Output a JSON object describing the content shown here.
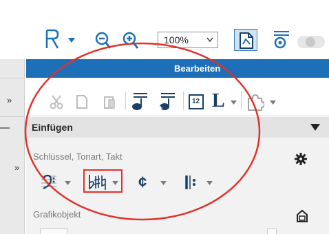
{
  "top_toolbar": {
    "zoom_level": "100%",
    "toggle_state": "off"
  },
  "ribbon": {
    "bearbeiten_title": "Bearbeiten",
    "edit_tools": [
      "cut-icon",
      "copy-icon",
      "paste-icon",
      "insert-note-icon",
      "insert-note-plus-icon",
      "number-box-icon",
      "text-style-icon",
      "plugin-icon"
    ],
    "number_box": "12",
    "text_style_glyph": "L"
  },
  "left_strip": {
    "expand_glyph": "»"
  },
  "einfuegen_panel": {
    "title": "Einfügen",
    "section_clef": "Schlüssel, Tonart, Takt",
    "section_graphic": "Grafikobjekt",
    "tools": [
      "bass-clef-icon",
      "key-signature-icon",
      "cut-time-icon",
      "repeat-start-icon"
    ],
    "cut_time_glyph": "¢",
    "repeat_glyph": "𝄆"
  },
  "colors": {
    "accent_blue": "#1d6fb8",
    "annotation_red": "#e0322a"
  }
}
